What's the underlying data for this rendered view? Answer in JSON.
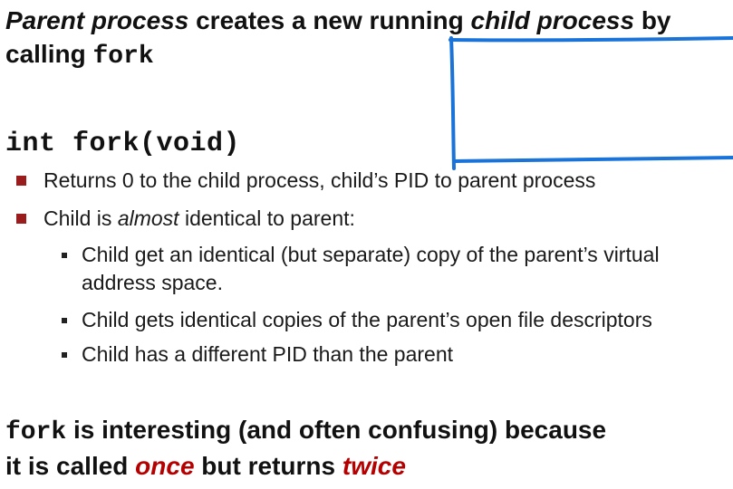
{
  "slide": {
    "intro": {
      "part1": "Parent process",
      "part2": " creates a new running ",
      "part3": "child process",
      "part4": " by",
      "line2_text": "calling ",
      "line2_code": "fork"
    },
    "signature": "int fork(void)",
    "bullets": [
      {
        "text": "Returns 0 to the child process, child’s PID to parent process"
      },
      {
        "before": "Child is ",
        "emphasis": "almost",
        "after": " identical to parent:",
        "sub": [
          "Child get an identical (but separate) copy of the parent’s virtual address space.",
          "Child gets identical copies of the parent’s open file descriptors",
          "Child has a different PID than the parent"
        ]
      }
    ],
    "note": {
      "code": "fork",
      "line1": " is interesting (and often confusing) because",
      "line2_before": "it is called ",
      "once": "once",
      "line2_middle": " but returns ",
      "twice": "twice"
    }
  },
  "colors": {
    "accent": "#b40000",
    "bullet_marker": "#9b1c1c",
    "annotation_ink": "#1a73d9"
  }
}
